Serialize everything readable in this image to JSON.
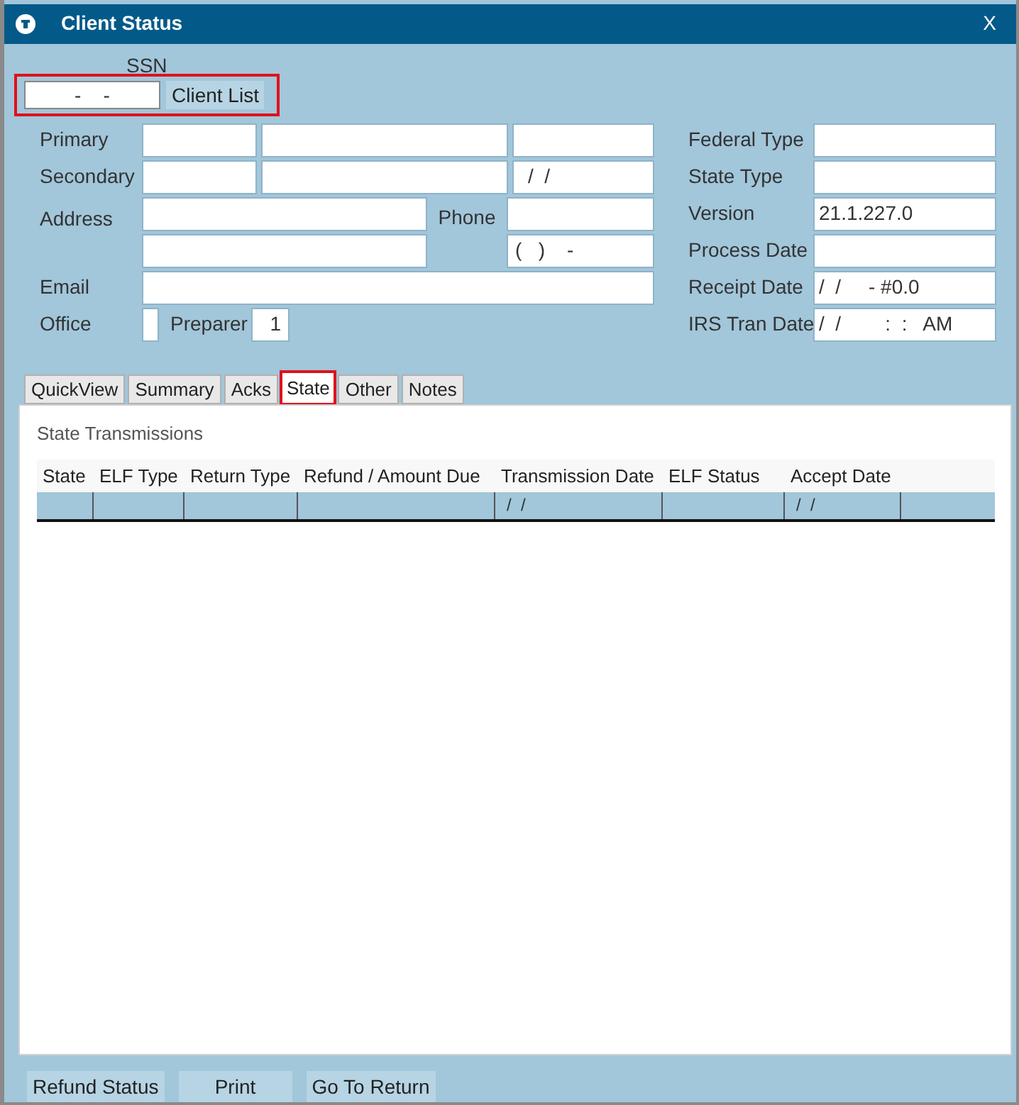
{
  "window": {
    "title": "Client Status",
    "close": "X"
  },
  "ssn": {
    "label": "SSN",
    "value": "-    -",
    "highlighted": true
  },
  "client_list_button": "Client List",
  "left_form": {
    "primary": {
      "label": "Primary"
    },
    "secondary": {
      "label": "Secondary",
      "date": "/  /"
    },
    "address": {
      "label": "Address"
    },
    "phone": {
      "label": "Phone",
      "value": "(   )    -"
    },
    "email": {
      "label": "Email"
    },
    "office": {
      "label": "Office"
    },
    "preparer": {
      "label": "Preparer",
      "value": "1"
    }
  },
  "right_form": [
    {
      "label": "Federal Type"
    },
    {
      "label": "State Type"
    },
    {
      "label": "Version",
      "value": "21.1.227.0"
    },
    {
      "label": "Process Date"
    },
    {
      "label": "Receipt Date",
      "value": "/  /     - #0.0"
    },
    {
      "label": "IRS Tran Date",
      "value": "/  /        :  :   AM"
    }
  ],
  "tabs": [
    {
      "label": "QuickView",
      "selected": false,
      "highlighted": false
    },
    {
      "label": "Summary",
      "selected": false,
      "highlighted": false
    },
    {
      "label": "Acks",
      "selected": false,
      "highlighted": false
    },
    {
      "label": "State",
      "selected": true,
      "highlighted": true
    },
    {
      "label": "Other",
      "selected": false,
      "highlighted": false
    },
    {
      "label": "Notes",
      "selected": false,
      "highlighted": false
    }
  ],
  "section_title": "State Transmissions",
  "table": {
    "columns": [
      {
        "label": "State"
      },
      {
        "label": "ELF Type"
      },
      {
        "label": "Return Type"
      },
      {
        "label": "Refund / Amount Due"
      },
      {
        "label": "Transmission Date",
        "cell": "/  /"
      },
      {
        "label": "ELF Status"
      },
      {
        "label": "Accept Date",
        "cell": "/  /"
      }
    ]
  },
  "buttons": [
    "Refund Status",
    "Print",
    "Go To Return"
  ]
}
